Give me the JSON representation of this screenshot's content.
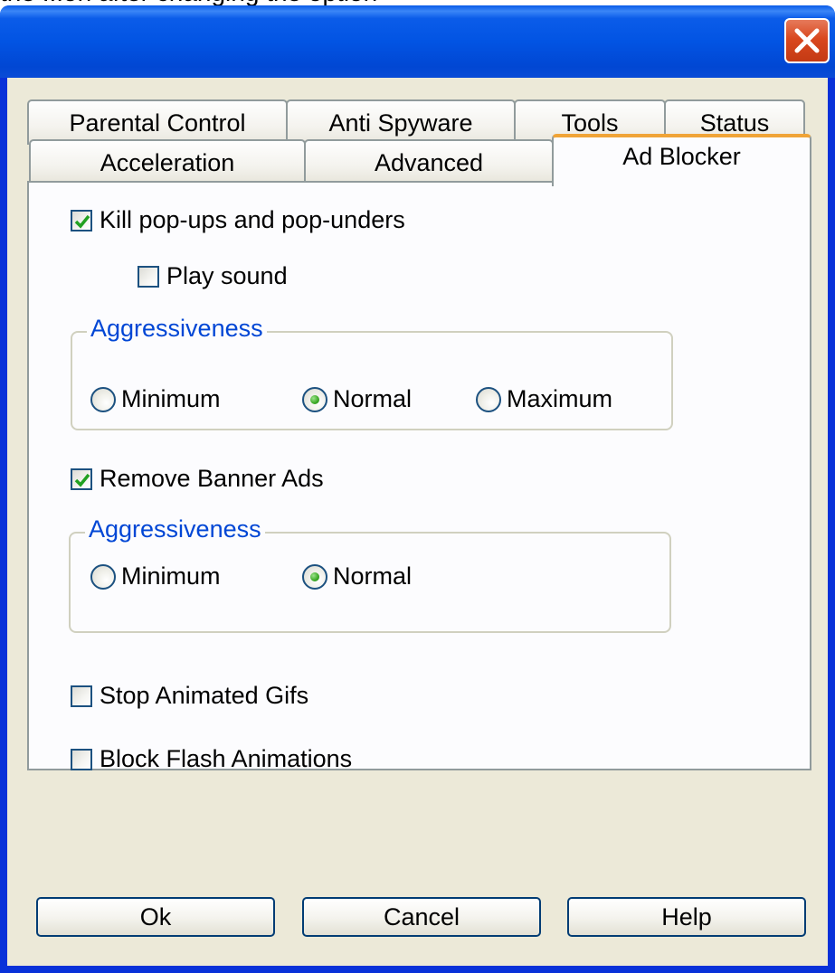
{
  "cut_text": "the ...on after changing the option",
  "tabs": {
    "row1": [
      {
        "label": "Parental Control"
      },
      {
        "label": "Anti Spyware"
      },
      {
        "label": "Tools"
      },
      {
        "label": "Status"
      }
    ],
    "row2": [
      {
        "label": "Acceleration"
      },
      {
        "label": "Advanced"
      },
      {
        "label": "Ad Blocker",
        "active": true
      }
    ]
  },
  "panel": {
    "kill_popups": {
      "label": "Kill pop-ups and pop-unders",
      "checked": true
    },
    "play_sound": {
      "label": "Play sound",
      "checked": false
    },
    "group1": {
      "legend": "Aggressiveness",
      "options": [
        {
          "label": "Minimum",
          "selected": false
        },
        {
          "label": "Normal",
          "selected": true
        },
        {
          "label": "Maximum",
          "selected": false
        }
      ]
    },
    "remove_banner": {
      "label": "Remove Banner Ads",
      "checked": true
    },
    "group2": {
      "legend": "Aggressiveness",
      "options": [
        {
          "label": "Minimum",
          "selected": false
        },
        {
          "label": "Normal",
          "selected": true
        }
      ]
    },
    "stop_gifs": {
      "label": "Stop Animated Gifs",
      "checked": false
    },
    "block_flash": {
      "label": "Block Flash Animations",
      "checked": false
    }
  },
  "buttons": {
    "ok": "Ok",
    "cancel": "Cancel",
    "help": "Help"
  },
  "colors": {
    "titlebar": "#0054e3",
    "window_bg": "#ece9d8",
    "panel_bg": "#fcfcfe",
    "active_tab_accent": "#f0a437",
    "legend_text": "#0046d5",
    "check_mark": "#21a121",
    "close_button": "#d9481f"
  },
  "icons": {
    "close": "close-x-icon",
    "check": "checkmark-icon"
  }
}
